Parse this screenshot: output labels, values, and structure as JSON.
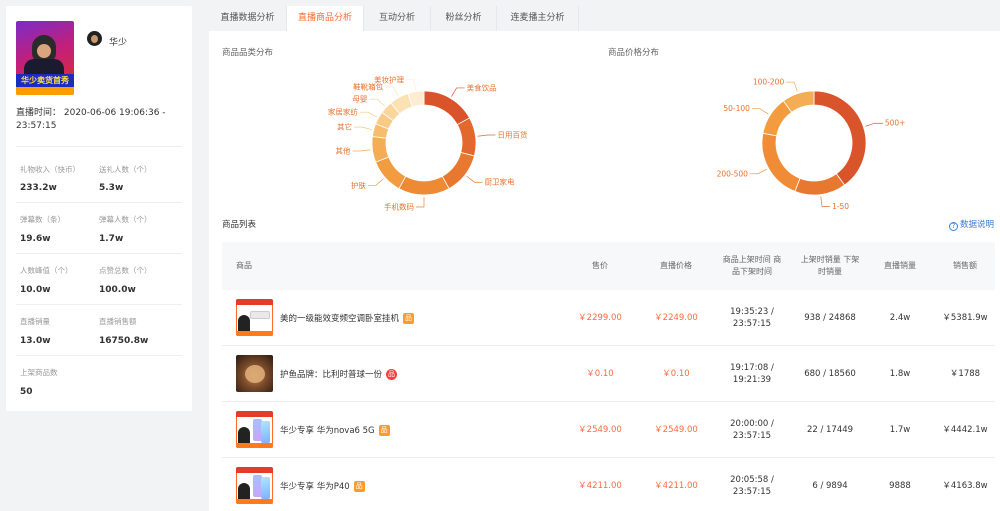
{
  "anchor": {
    "name": "华少",
    "cover_banner": "华少卖货首秀",
    "live_time": "直播时间：  2020-06-06 19:06:36 - 23:57:15"
  },
  "stats": [
    {
      "label": "礼物收入（快币）",
      "value": "233.2w"
    },
    {
      "label": "送礼人数（个）",
      "value": "5.3w"
    },
    {
      "label": "弹幕数（条）",
      "value": "19.6w"
    },
    {
      "label": "弹幕人数（个）",
      "value": "1.7w"
    },
    {
      "label": "人数峰值（个）",
      "value": "10.0w"
    },
    {
      "label": "点赞总数（个）",
      "value": "100.0w"
    },
    {
      "label": "直播销量",
      "value": "13.0w"
    },
    {
      "label": "直播销售额",
      "value": "16750.8w"
    },
    {
      "label": "上架商品数",
      "value": "50"
    }
  ],
  "tabs": [
    {
      "label": "直播数据分析",
      "active": false
    },
    {
      "label": "直播商品分析",
      "active": true
    },
    {
      "label": "互动分析",
      "active": false
    },
    {
      "label": "粉丝分析",
      "active": false
    },
    {
      "label": "连麦播主分析",
      "active": false
    }
  ],
  "category_section_title": "商品品类分布",
  "price_section_title": "商品价格分布",
  "chart_data": [
    {
      "type": "pie",
      "variant": "donut",
      "categories": [
        "美食饮品",
        "日用百货",
        "厨卫家电",
        "手机数码",
        "护肤",
        "其他",
        "其它",
        "家居家纺",
        "母婴",
        "鞋靴箱包",
        "美妆护理"
      ],
      "values": [
        17,
        12,
        13,
        16,
        11,
        8,
        4,
        4,
        4,
        6,
        5
      ],
      "colors": [
        "#d9532b",
        "#e2682d",
        "#e8772f",
        "#ee8a33",
        "#f29b3f",
        "#f5ad55",
        "#f7bd6e",
        "#f9ca86",
        "#fad69c",
        "#fbe1b4",
        "#fdecd1"
      ]
    },
    {
      "type": "pie",
      "variant": "donut",
      "categories": [
        "500+",
        "1-50",
        "200-500",
        "50-100",
        "100-200"
      ],
      "values": [
        40,
        16,
        22,
        12,
        10
      ],
      "colors": [
        "#d9532b",
        "#e8772f",
        "#ef8c35",
        "#f29b3f",
        "#f5ad55"
      ]
    }
  ],
  "goods_list": {
    "title": "商品列表",
    "help_text": "数据说明",
    "headers": {
      "goods": "商品",
      "price": "售价",
      "live_price": "直播价格",
      "shelf_time": "商品上架时间 商品下架时间",
      "shelf_sales": "上架时销量 下架时销量",
      "live_sales": "直播销量",
      "revenue": "销售额"
    },
    "rows": [
      {
        "name": "美的一级能效变频空调卧室挂机",
        "badge": "品",
        "badge_type": "square",
        "price": "￥2299.00",
        "live_price": "￥2249.00",
        "time": "19:35:23 / 23:57:15",
        "sales": "938 / 24868",
        "live_sales": "2.4w",
        "revenue": "￥5381.9w",
        "thumb": "aircon"
      },
      {
        "name": "护鱼品牌：比利时普球一份",
        "badge": "品",
        "badge_type": "round",
        "price": "￥0.10",
        "live_price": "￥0.10",
        "time": "19:17:08 / 19:21:39",
        "sales": "680 / 18560",
        "live_sales": "1.8w",
        "revenue": "￥1788",
        "thumb": "food"
      },
      {
        "name": "华少专享 华为nova6 5G",
        "badge": "品",
        "badge_type": "square",
        "price": "￥2549.00",
        "live_price": "￥2549.00",
        "time": "20:00:00 / 23:57:15",
        "sales": "22 / 17449",
        "live_sales": "1.7w",
        "revenue": "￥4442.1w",
        "thumb": "phone"
      },
      {
        "name": "华少专享 华为P40",
        "badge": "品",
        "badge_type": "square",
        "price": "￥4211.00",
        "live_price": "￥4211.00",
        "time": "20:05:58 / 23:57:15",
        "sales": "6 / 9894",
        "live_sales": "9888",
        "revenue": "￥4163.8w",
        "thumb": "phone"
      }
    ]
  }
}
